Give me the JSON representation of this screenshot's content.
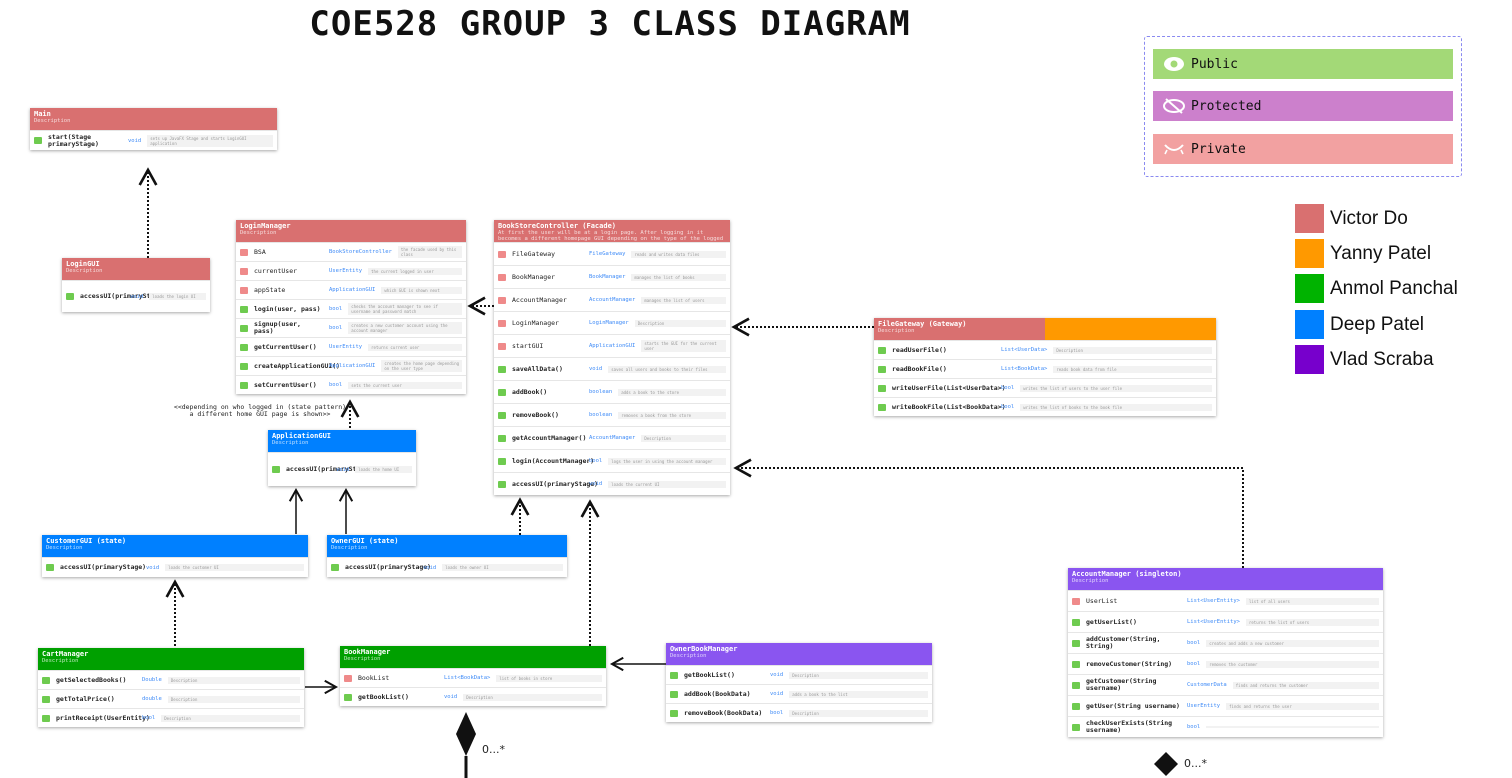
{
  "title": "COE528 GROUP 3 CLASS DIAGRAM",
  "legend": {
    "public": "Public",
    "protected": "Protected",
    "private": "Private",
    "colors": {
      "public": "#a3d977",
      "protected": "#cc80cc",
      "private": "#f2a1a1"
    }
  },
  "team": [
    {
      "name": "Victor Do",
      "color": "#d97070"
    },
    {
      "name": "Yanny Patel",
      "color": "#ff9900"
    },
    {
      "name": "Anmol Panchal",
      "color": "#00b300"
    },
    {
      "name": "Deep Patel",
      "color": "#0080ff"
    },
    {
      "name": "Vlad Scraba",
      "color": "#7700cc"
    }
  ],
  "annotation": "<<depending on who logged in (state pattern)\na different home GUI page is shown>>",
  "multiplicity": {
    "book": "0...*",
    "account": "0...*"
  },
  "classes": {
    "main": {
      "name": "Main",
      "desc": "Description",
      "members": [
        {
          "vis": "pub",
          "name": "start(Stage primaryStage)",
          "type": "void",
          "desc": "sets up JavaFX Stage and starts LoginGUI application"
        }
      ]
    },
    "logingui": {
      "name": "LoginGUI",
      "desc": "Description",
      "members": [
        {
          "vis": "pub",
          "name": "accessUI(primaryStage)",
          "type": "void",
          "desc": "loads the login UI"
        }
      ]
    },
    "loginmanager": {
      "name": "LoginManager",
      "desc": "Description",
      "members": [
        {
          "vis": "pri",
          "name": "BSA",
          "type": "BookStoreController",
          "desc": "the facade used by this class"
        },
        {
          "vis": "pri",
          "name": "currentUser",
          "type": "UserEntity",
          "desc": "the current logged in user"
        },
        {
          "vis": "pri",
          "name": "appState",
          "type": "ApplicationGUI",
          "desc": "which GUI is shown next"
        },
        {
          "vis": "pub",
          "name": "login(user, pass)",
          "type": "bool",
          "desc": "checks the account manager to see if username and password match"
        },
        {
          "vis": "pub",
          "name": "signup(user, pass)",
          "type": "bool",
          "desc": "creates a new customer account using the account manager"
        },
        {
          "vis": "pub",
          "name": "getCurrentUser()",
          "type": "UserEntity",
          "desc": "returns current user"
        },
        {
          "vis": "pub",
          "name": "createApplicationGUI()",
          "type": "ApplicationGUI",
          "desc": "creates the home page depending on the user type"
        },
        {
          "vis": "pub",
          "name": "setCurrentUser()",
          "type": "bool",
          "desc": "sets the current user"
        }
      ]
    },
    "facade": {
      "name": "BookStoreController (Facade)",
      "desc": "At first the user will be at a login page. After logging in it becomes a different homepage GUI depending on the type of the logged in user",
      "members": [
        {
          "vis": "pri",
          "name": "FileGateway",
          "type": "FileGateway",
          "desc": "reads and writes data files"
        },
        {
          "vis": "pri",
          "name": "BookManager",
          "type": "BookManager",
          "desc": "manages the list of books"
        },
        {
          "vis": "pri",
          "name": "AccountManager",
          "type": "AccountManager",
          "desc": "manages the list of users"
        },
        {
          "vis": "pri",
          "name": "LoginManager",
          "type": "LoginManager",
          "desc": "Description"
        },
        {
          "vis": "pri",
          "name": "startGUI",
          "type": "ApplicationGUI",
          "desc": "starts the GUI for the current user"
        },
        {
          "vis": "pub",
          "name": "saveAllData()",
          "type": "void",
          "desc": "saves all users and books to their files"
        },
        {
          "vis": "pub",
          "name": "addBook()",
          "type": "boolean",
          "desc": "adds a book to the store"
        },
        {
          "vis": "pub",
          "name": "removeBook()",
          "type": "boolean",
          "desc": "removes a book from the store"
        },
        {
          "vis": "pub",
          "name": "getAccountManager()",
          "type": "AccountManager",
          "desc": "Description"
        },
        {
          "vis": "pub",
          "name": "login(AccountManager)",
          "type": "bool",
          "desc": "logs the user in using the account manager"
        },
        {
          "vis": "pub",
          "name": "accessUI(primaryStage)",
          "type": "void",
          "desc": "loads the current UI"
        }
      ]
    },
    "filegateway": {
      "name": "FileGateway (Gateway)",
      "desc": "Description",
      "members": [
        {
          "vis": "pub",
          "name": "readUserFile()",
          "type": "List<UserData>",
          "desc": "Description"
        },
        {
          "vis": "pub",
          "name": "readBookFile()",
          "type": "List<BookData>",
          "desc": "reads book data from file"
        },
        {
          "vis": "pub",
          "name": "writeUserFile(List<UserData>)",
          "type": "bool",
          "desc": "writes the list of users to the user file"
        },
        {
          "vis": "pub",
          "name": "writeBookFile(List<BookData>)",
          "type": "bool",
          "desc": "writes the list of books to the book file"
        }
      ]
    },
    "appgui": {
      "name": "ApplicationGUI",
      "desc": "Description",
      "members": [
        {
          "vis": "pub",
          "name": "accessUI(primaryStage)",
          "type": "void",
          "desc": "loads the home UI"
        }
      ]
    },
    "customergui": {
      "name": "CustomerGUI (state)",
      "desc": "Description",
      "members": [
        {
          "vis": "pub",
          "name": "accessUI(primaryStage)",
          "type": "void",
          "desc": "loads the customer UI"
        }
      ]
    },
    "ownergui": {
      "name": "OwnerGUI (state)",
      "desc": "Description",
      "members": [
        {
          "vis": "pub",
          "name": "accessUI(primaryStage)",
          "type": "void",
          "desc": "loads the owner UI"
        }
      ]
    },
    "cartmanager": {
      "name": "CartManager",
      "desc": "Description",
      "members": [
        {
          "vis": "pub",
          "name": "getSelectedBooks()",
          "type": "Double",
          "desc": "Description"
        },
        {
          "vis": "pub",
          "name": "getTotalPrice()",
          "type": "double",
          "desc": "Description"
        },
        {
          "vis": "pub",
          "name": "printReceipt(UserEntity)",
          "type": "bool",
          "desc": "Description"
        }
      ]
    },
    "bookmanager": {
      "name": "BookManager",
      "desc": "Description",
      "members": [
        {
          "vis": "pri",
          "name": "BookList",
          "type": "List<BookData>",
          "desc": "list of books in store"
        },
        {
          "vis": "pub",
          "name": "getBookList()",
          "type": "void",
          "desc": "Description"
        }
      ]
    },
    "ownerbookmanager": {
      "name": "OwnerBookManager",
      "desc": "Description",
      "members": [
        {
          "vis": "pub",
          "name": "getBookList()",
          "type": "void",
          "desc": "Description"
        },
        {
          "vis": "pub",
          "name": "addBook(BookData)",
          "type": "void",
          "desc": "adds a book to the list"
        },
        {
          "vis": "pub",
          "name": "removeBook(BookData)",
          "type": "bool",
          "desc": "Description"
        }
      ]
    },
    "accountmanager": {
      "name": "AccountManager (singleton)",
      "desc": "Description",
      "members": [
        {
          "vis": "pri",
          "name": "UserList",
          "type": "List<UserEntity>",
          "desc": "list of all users"
        },
        {
          "vis": "pub",
          "name": "getUserList()",
          "type": "List<UserEntity>",
          "desc": "returns the list of users"
        },
        {
          "vis": "pub",
          "name": "addCustomer(String, String)",
          "type": "bool",
          "desc": "creates and adds a new customer"
        },
        {
          "vis": "pub",
          "name": "removeCustomer(String)",
          "type": "bool",
          "desc": "removes the customer"
        },
        {
          "vis": "pub",
          "name": "getCustomer(String username)",
          "type": "CustomerData",
          "desc": "finds and returns the customer"
        },
        {
          "vis": "pub",
          "name": "getUser(String username)",
          "type": "UserEntity",
          "desc": "finds and returns the user"
        },
        {
          "vis": "pub",
          "name": "checkUserExists(String username)",
          "type": "bool",
          "desc": ""
        }
      ]
    }
  }
}
